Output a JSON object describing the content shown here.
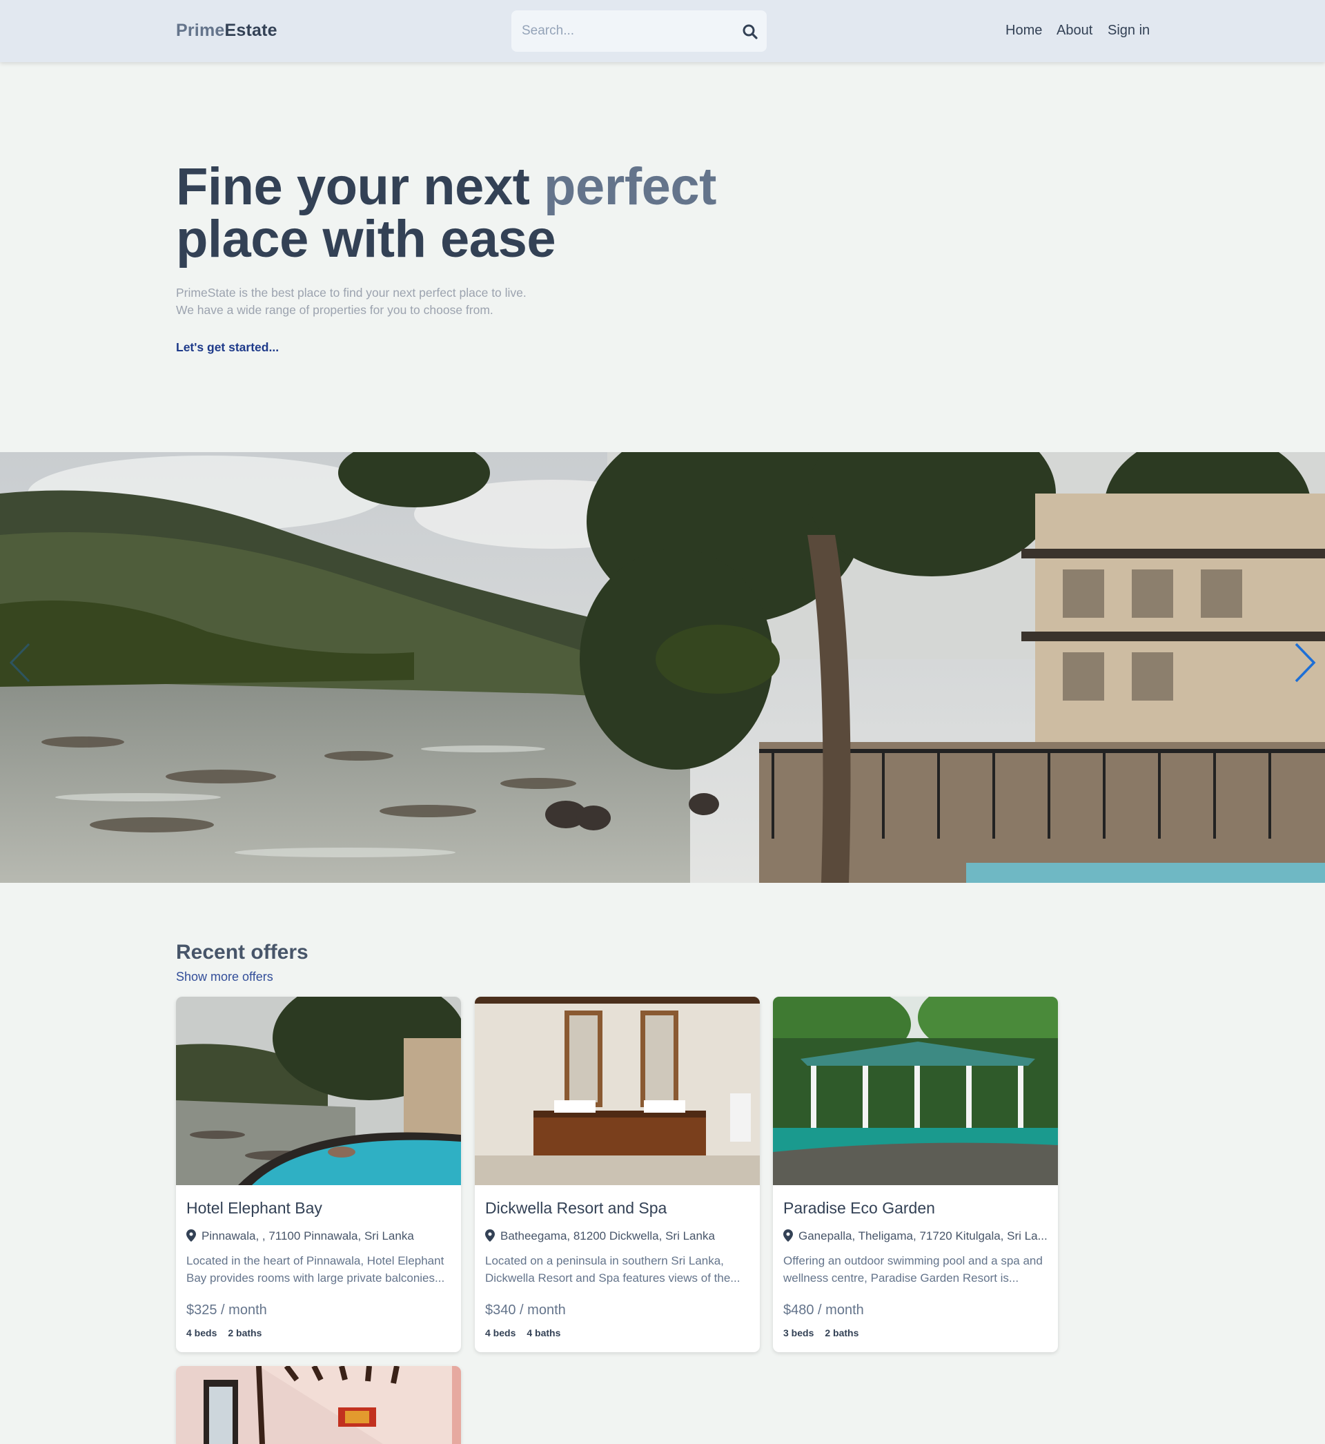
{
  "header": {
    "logo_prime": "Prime",
    "logo_estate": "Estate",
    "search_placeholder": "Search...",
    "nav": {
      "home": "Home",
      "about": "About",
      "signin": "Sign in"
    }
  },
  "hero": {
    "title_part1": "Fine your next ",
    "title_accent": "perfect",
    "title_part2": "place with ease",
    "desc_line1": "PrimeState is the best place to find your next perfect place to live.",
    "desc_line2": "We have a wide range of properties for you to choose from.",
    "cta": "Let's get started..."
  },
  "offers": {
    "title": "Recent offers",
    "more": "Show more offers",
    "items": [
      {
        "title": "Hotel Elephant Bay",
        "location": "Pinnawala, , 71100 Pinnawala, Sri Lanka",
        "desc": "Located in the heart of Pinnawala, Hotel Elephant Bay provides rooms with large private balconies...",
        "price": "$325 / month",
        "beds": "4 beds",
        "baths": "2 baths"
      },
      {
        "title": "Dickwella Resort and Spa",
        "location": "Batheegama, 81200 Dickwella, Sri Lanka",
        "desc": "Located on a peninsula in southern Sri Lanka, Dickwella Resort and Spa features views of the...",
        "price": "$340 / month",
        "beds": "4 beds",
        "baths": "4 baths"
      },
      {
        "title": "Paradise Eco Garden",
        "location": "Ganepalla, Theligama, 71720 Kitulgala, Sri La...",
        "desc": "Offering an outdoor swimming pool and a spa and wellness centre, Paradise Garden Resort is...",
        "price": "$480 / month",
        "beds": "3 beds",
        "baths": "2 baths"
      }
    ]
  },
  "colors": {
    "background": "#f1f4f2",
    "header": "#e2e8f0",
    "accent": "#64748b",
    "cta": "#1e3a8a",
    "slider_arrow": "#1d6fd6"
  }
}
